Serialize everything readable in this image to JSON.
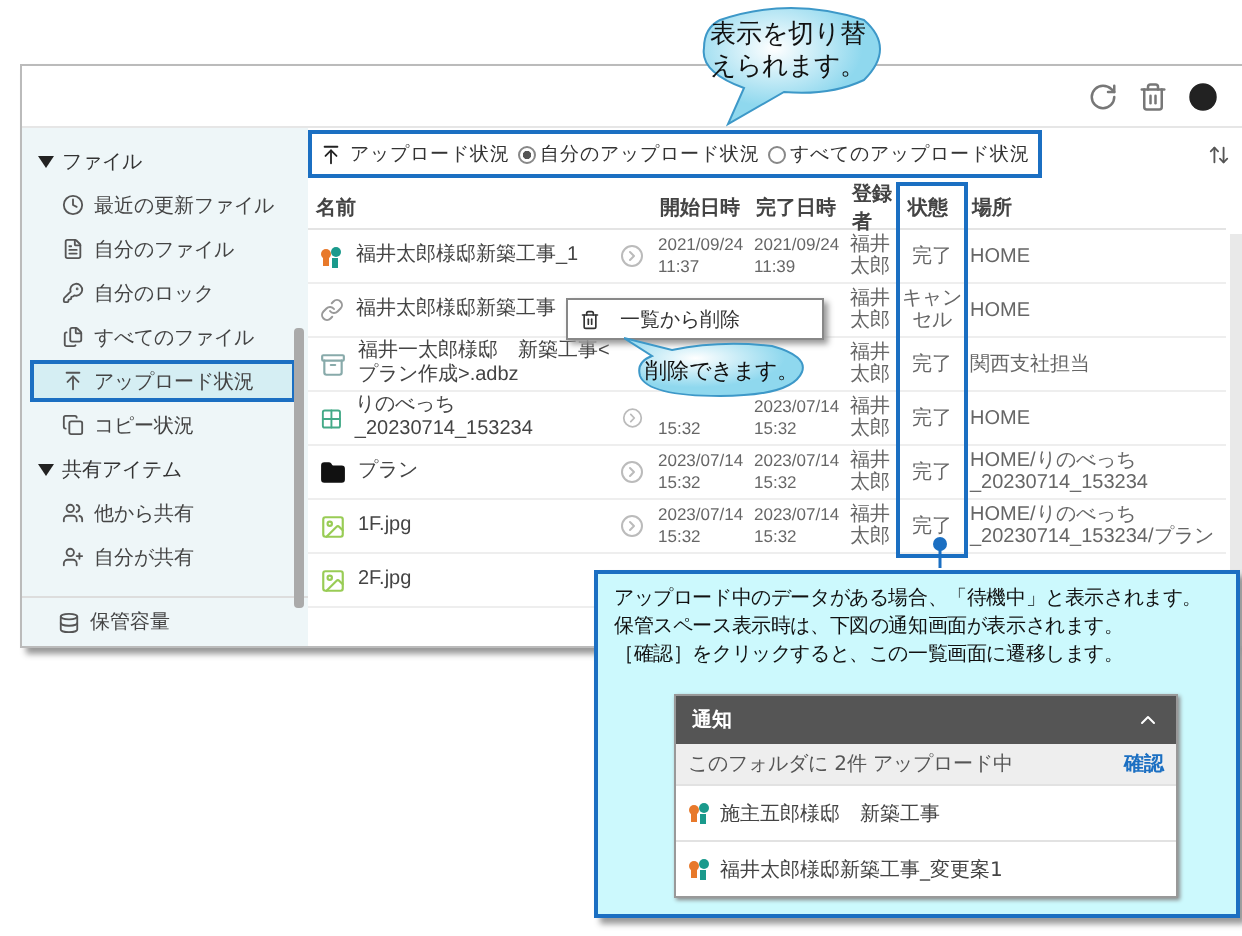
{
  "header": {
    "actions": [
      {
        "kind": "reload"
      },
      {
        "kind": "trash"
      },
      {
        "kind": "user"
      }
    ]
  },
  "sidebar": {
    "sections": [
      {
        "label": "ファイル",
        "expanded": true,
        "items": [
          {
            "label": "最近の更新ファイル",
            "kind": "clock",
            "selected": false
          },
          {
            "label": "自分のファイル",
            "kind": "file",
            "selected": false
          },
          {
            "label": "自分のロック",
            "kind": "key",
            "selected": false
          },
          {
            "label": "すべてのファイル",
            "kind": "files",
            "selected": false
          },
          {
            "label": "アップロード状況",
            "kind": "upload",
            "selected": true
          },
          {
            "label": "コピー状況",
            "kind": "copy",
            "selected": false
          }
        ]
      },
      {
        "label": "共有アイテム",
        "expanded": true,
        "items": [
          {
            "label": "他から共有",
            "kind": "users",
            "selected": false
          },
          {
            "label": "自分が共有",
            "kind": "share",
            "selected": false
          }
        ]
      }
    ],
    "footer": {
      "label": "保管容量"
    }
  },
  "toolbar": {
    "title": "アップロード状況",
    "options": [
      {
        "label": "自分のアップロード状況",
        "selected": true
      },
      {
        "label": "すべてのアップロード状況",
        "selected": false
      }
    ]
  },
  "table": {
    "columns": [
      "名前",
      "開始日時",
      "完了日時",
      "登録者",
      "状態",
      "場所"
    ],
    "rows": [
      {
        "kind": "project",
        "name": "福井太郎様邸新築工事_1",
        "action": true,
        "start": "2021/09/24 11:37",
        "end": "2021/09/24 11:39",
        "registrar": "福井太郎",
        "status": "完了",
        "location": "HOME"
      },
      {
        "kind": "link",
        "name": "福井太郎様邸新築工事",
        "action": false,
        "registrar": "福井太郎",
        "status": "キャンセル",
        "location": "HOME"
      },
      {
        "kind": "archive",
        "name": "福井一太郎様邸　新築工事<プラン作成>.adbz",
        "action": false,
        "registrar": "福井太郎",
        "status": "完了",
        "location": "関西支社担当"
      },
      {
        "kind": "grid",
        "name": "りのべっち_20230714_153234",
        "action": true,
        "start": "15:32",
        "end": "2023/07/14 15:32",
        "registrar": "福井太郎",
        "status": "完了",
        "location": "HOME"
      },
      {
        "kind": "folder",
        "name": "プラン",
        "action": true,
        "start": "2023/07/14 15:32",
        "end": "2023/07/14 15:32",
        "registrar": "福井太郎",
        "status": "完了",
        "location": "HOME/りのべっち _20230714_153234"
      },
      {
        "kind": "image",
        "name": "1F.jpg",
        "action": true,
        "start": "2023/07/14 15:32",
        "end": "2023/07/14 15:32",
        "registrar": "福井太郎",
        "status": "完了",
        "location": "HOME/りのべっち _20230714_153234/プラン"
      },
      {
        "kind": "image",
        "name": "2F.jpg",
        "action": false
      }
    ]
  },
  "context_menu": {
    "items": [
      {
        "label": "一覧から削除"
      }
    ]
  },
  "callouts": [
    {
      "text": "表示を切り替えられます。"
    },
    {
      "text": "削除できます。"
    }
  ],
  "note": {
    "lines": [
      "アップロード中のデータがある場合、「待機中」と表示されます。",
      "保管スペース表示時は、下図の通知画面が表示されます。",
      "［確認］をクリックすると、この一覧画面に遷移します。"
    ],
    "notification": {
      "title": "通知",
      "summary": "このフォルダに 2件 アップロード中",
      "action": "確認",
      "items": [
        {
          "name": "施主五郎様邸　新築工事"
        },
        {
          "name": "福井太郎様邸新築工事_変更案1"
        }
      ]
    }
  }
}
